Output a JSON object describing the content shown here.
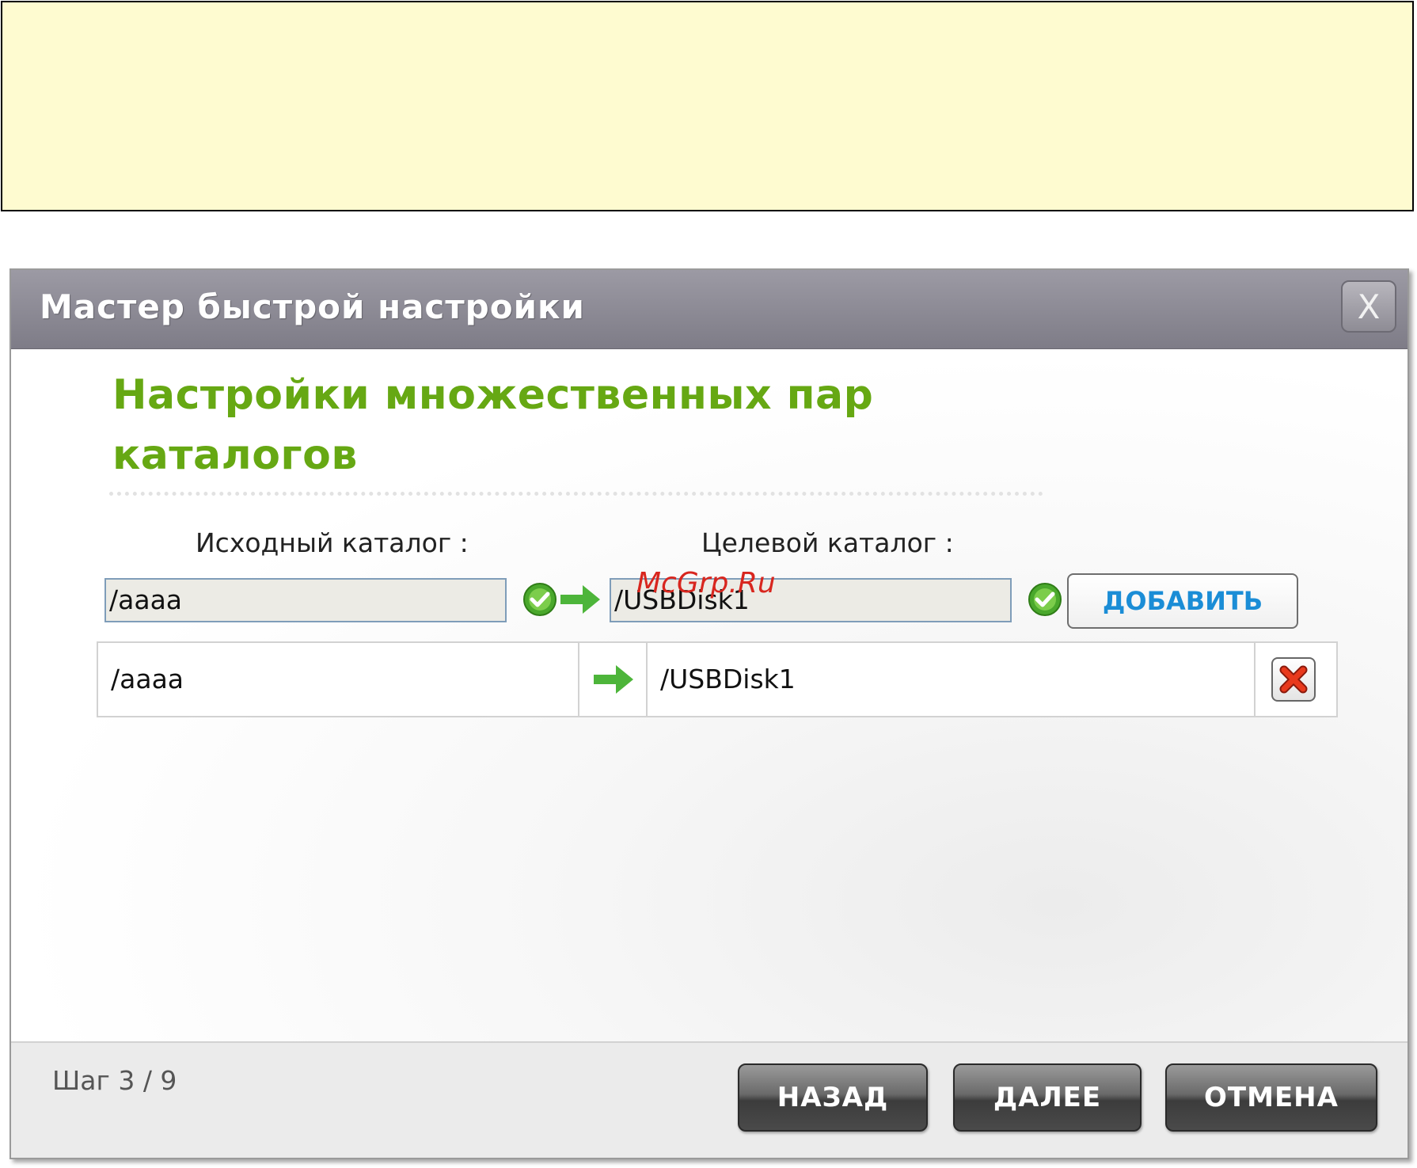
{
  "dialog": {
    "title": "Мастер быстрой настройки",
    "close_label": "X"
  },
  "content": {
    "heading_line1": "Настройки множественных пар",
    "heading_line2": "каталогов",
    "source_label": "Исходный каталог :",
    "target_label": "Целевой каталог :",
    "source_value": "/aaaa",
    "target_value": "/USBDisk1",
    "add_button": "ДОБАВИТЬ",
    "watermark": "McGrp.Ru"
  },
  "pairs": [
    {
      "source": "/aaaa",
      "target": "/USBDisk1"
    }
  ],
  "footer": {
    "step": "Шаг 3 / 9",
    "back_button": "НАЗАД",
    "next_button": "ДАЛЕЕ",
    "cancel_button": "ОТМЕНА"
  },
  "colors": {
    "heading": "#66a813",
    "add_button_text": "#1b8dd6",
    "note_background": "#fefbd0",
    "check": "#4aa82c",
    "delete": "#e8391c"
  },
  "icons": [
    "valid-check-icon",
    "green-arrow-icon",
    "delete-x-icon",
    "close-icon"
  ]
}
